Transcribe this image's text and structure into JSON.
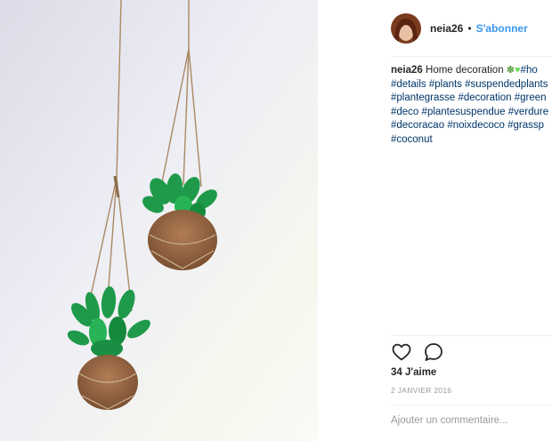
{
  "post": {
    "username": "neia26",
    "separator": "•",
    "follow_label": "S'abonner",
    "caption_user": "neia26",
    "caption_text": "Home decoration",
    "caption_emojis": [
      "herb-emoji",
      "green-heart-emoji"
    ],
    "hashtag_lines": [
      [
        "#ho"
      ],
      [
        "#details",
        "#plants",
        "#suspendedplants"
      ],
      [
        "#plantegrasse",
        "#decoration",
        "#green"
      ],
      [
        "#deco",
        "#plantesuspendue",
        "#verdure"
      ],
      [
        "#decoracao",
        "#noixdecoco",
        "#grassp"
      ],
      [
        "#coconut"
      ]
    ],
    "likes": "34 J'aime",
    "date": "2 JANVIER 2016",
    "comment_placeholder": "Ajouter un commentaire...",
    "icons": {
      "like": "heart-icon",
      "comment": "comment-bubble-icon"
    },
    "colors": {
      "link": "#3897f0",
      "hashtag": "#003569",
      "muted": "#999999",
      "text": "#262626"
    }
  }
}
